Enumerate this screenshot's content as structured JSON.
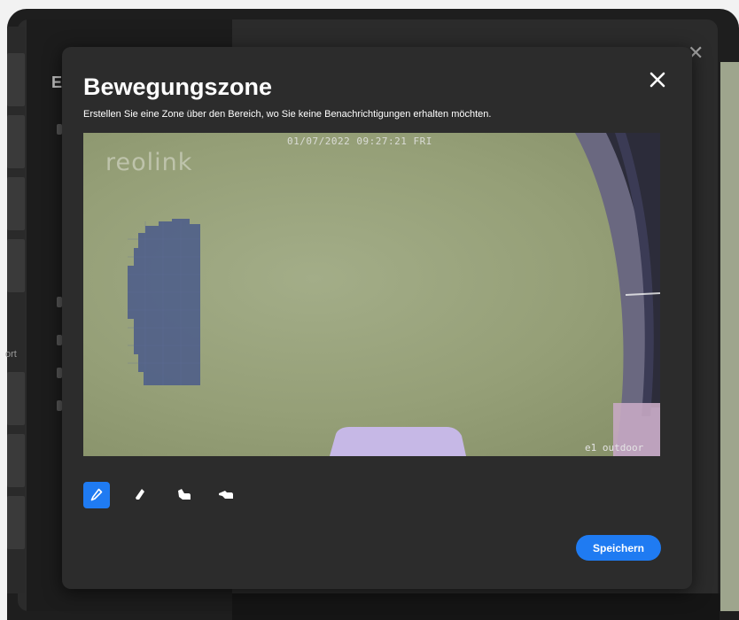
{
  "background": {
    "dialog_letter": "E",
    "left_label": "ort"
  },
  "modal": {
    "title": "Bewegungszone",
    "subtitle": "Erstellen Sie eine Zone über den Bereich, wo Sie keine Benachrichtigungen erhalten möchten.",
    "close_icon": "close-icon",
    "camera": {
      "timestamp": "01/07/2022 09:27:21 FRI",
      "logo": "reolink",
      "camera_name": "e1 outdoor"
    },
    "tools": [
      {
        "name": "pencil-icon",
        "active": true
      },
      {
        "name": "eraser-icon",
        "active": false
      },
      {
        "name": "select-all-icon",
        "active": false
      },
      {
        "name": "clear-all-icon",
        "active": false
      }
    ],
    "save_label": "Speichern"
  },
  "colors": {
    "accent": "#1f7bf2",
    "modal_bg": "#2c2c2c",
    "zone_overlay": "#4a5a8a"
  }
}
